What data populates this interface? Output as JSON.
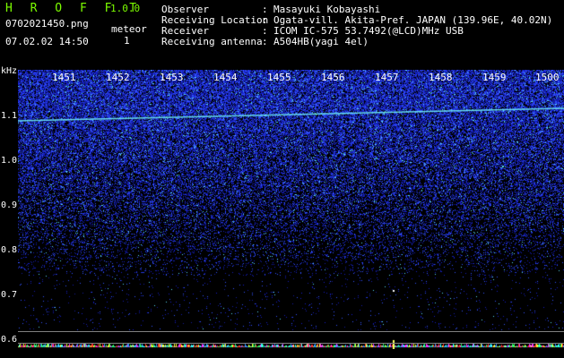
{
  "app": {
    "name": "H R O F F T",
    "version": "1.0.0"
  },
  "file": {
    "name": "0702021450.png",
    "timestamp": "07.02.02 14:50"
  },
  "meteor": {
    "label": "meteor",
    "count": "1"
  },
  "info": [
    {
      "label": "Observer",
      "value": "Masayuki Kobayashi"
    },
    {
      "label": "Receiving Location",
      "value": "Ogata-vill. Akita-Pref. JAPAN (139.96E, 40.02N)"
    },
    {
      "label": "Receiver",
      "value": "ICOM IC-575 53.7492(@LCD)MHz USB"
    },
    {
      "label": "Receiving antenna",
      "value": "A504HB(yagi 4el)"
    }
  ],
  "separator": ":",
  "axis": {
    "freq_unit": "kHz",
    "freq_ticks": [
      "1.1",
      "1.0",
      "0.9",
      "0.8",
      "0.7",
      "0.6"
    ],
    "time_ticks": [
      "1451",
      "1452",
      "1453",
      "1454",
      "1455",
      "1456",
      "1457",
      "1458",
      "1459",
      "1500"
    ]
  },
  "colors": {
    "title_green": "#7CFC00",
    "noise_blue": "#2233cc",
    "echo_cyan": "#66ddee",
    "text_white": "#ffffff"
  }
}
